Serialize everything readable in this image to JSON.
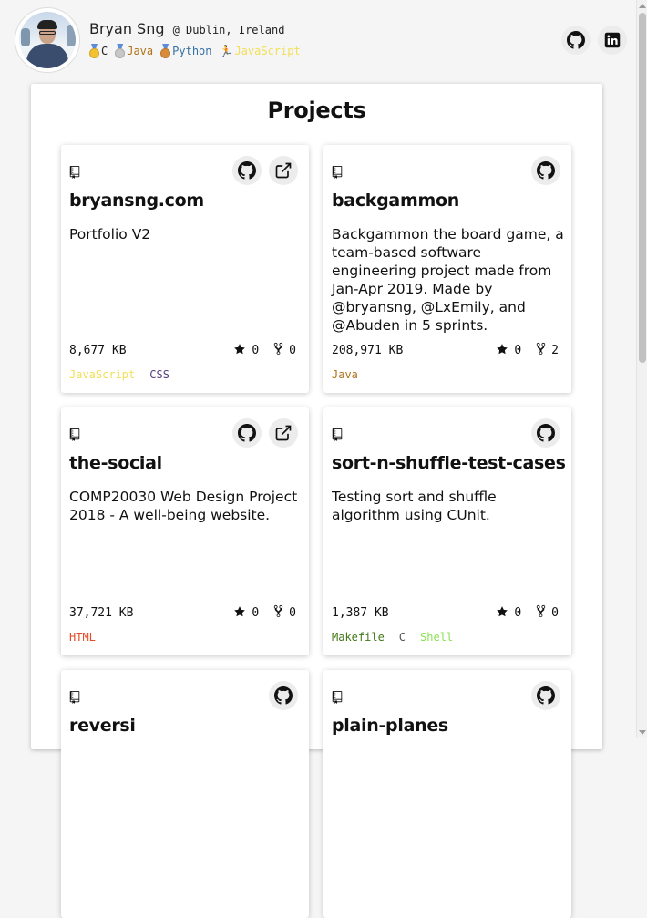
{
  "profile": {
    "name": "Bryan Sng",
    "location": "@ Dublin, Ireland",
    "skills": [
      {
        "label": "C",
        "medal": "gold-medal-icon",
        "color": "#222222"
      },
      {
        "label": "Java",
        "medal": "silver-medal-icon",
        "color": "#b07219"
      },
      {
        "label": "Python",
        "medal": "bronze-medal-icon",
        "color": "#3572A5"
      },
      {
        "label": "JavaScript",
        "medal": "runner-icon",
        "color": "#f1e05a"
      }
    ],
    "social": [
      "github-icon",
      "linkedin-icon"
    ]
  },
  "section_title": "Projects",
  "projects": [
    {
      "name": "bryansng.com",
      "description": "Portfolio V2",
      "size": "8,677 KB",
      "stars": "0",
      "forks": "0",
      "has_site": true,
      "languages": [
        {
          "name": "JavaScript",
          "color": "#f1e05a"
        },
        {
          "name": "CSS",
          "color": "#563d7c"
        }
      ]
    },
    {
      "name": "backgammon",
      "description": "Backgammon the board game, a team-based software engineering project made from Jan-Apr 2019. Made by @bryansng, @LxEmily, and @Abuden in 5 sprints.",
      "size": "208,971 KB",
      "stars": "0",
      "forks": "2",
      "has_site": false,
      "languages": [
        {
          "name": "Java",
          "color": "#b07219"
        }
      ]
    },
    {
      "name": "the-social",
      "description": "COMP20030 Web Design Project 2018 - A well-being website.",
      "size": "37,721 KB",
      "stars": "0",
      "forks": "0",
      "has_site": true,
      "languages": [
        {
          "name": "HTML",
          "color": "#e34c26"
        }
      ]
    },
    {
      "name": "sort-n-shuffle-test-cases",
      "description": "Testing sort and shuffle algorithm using CUnit.",
      "size": "1,387 KB",
      "stars": "0",
      "forks": "0",
      "has_site": false,
      "languages": [
        {
          "name": "Makefile",
          "color": "#427819"
        },
        {
          "name": "C",
          "color": "#555555"
        },
        {
          "name": "Shell",
          "color": "#89e051"
        }
      ]
    },
    {
      "name": "reversi",
      "description": "",
      "size": "",
      "stars": "",
      "forks": "",
      "has_site": false,
      "languages": []
    },
    {
      "name": "plain-planes",
      "description": "",
      "size": "",
      "stars": "",
      "forks": "",
      "has_site": false,
      "languages": []
    }
  ]
}
